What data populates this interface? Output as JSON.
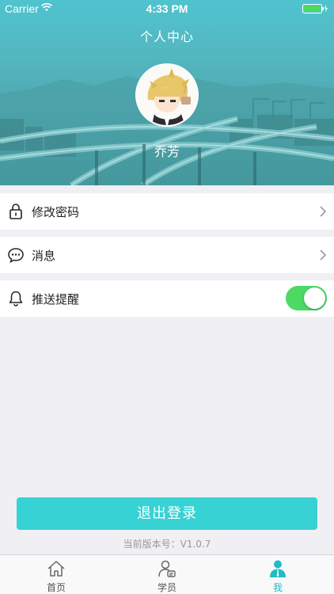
{
  "status_bar": {
    "carrier": "Carrier",
    "time": "4:33 PM"
  },
  "header": {
    "title": "个人中心",
    "username": "乔芳"
  },
  "menu": {
    "items": [
      {
        "label": "修改密码",
        "icon": "lock-icon",
        "accessory": "chevron"
      },
      {
        "label": "消息",
        "icon": "chat-bubble-icon",
        "accessory": "chevron"
      },
      {
        "label": "推送提醒",
        "icon": "bell-icon",
        "accessory": "toggle",
        "toggle_on": true
      }
    ]
  },
  "logout_label": "退出登录",
  "version_text": "当前版本号：V1.0.7",
  "tabs": [
    {
      "label": "首页",
      "icon": "home-icon",
      "active": false
    },
    {
      "label": "学员",
      "icon": "students-icon",
      "active": false
    },
    {
      "label": "我",
      "icon": "me-icon",
      "active": true
    }
  ],
  "colors": {
    "accent": "#37d2d4",
    "tab_active": "#1fbcc8",
    "toggle_on": "#4cd964",
    "background": "#efeff4"
  }
}
